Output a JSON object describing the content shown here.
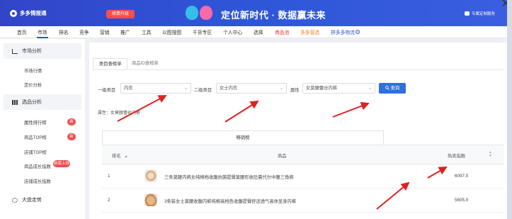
{
  "header": {
    "logo_text": "多多情报通",
    "upgrade_label": "续费升级",
    "slogan": "定位新时代 · 数据赢未来",
    "service_label": "专属定制服务",
    "close_symbol": "✕"
  },
  "nav": {
    "items": [
      {
        "label": "首页"
      },
      {
        "label": "市场"
      },
      {
        "label": "排名"
      },
      {
        "label": "竞争"
      },
      {
        "label": "营销"
      },
      {
        "label": "推广"
      },
      {
        "label": "工具"
      },
      {
        "label": "以图搜图"
      },
      {
        "label": "千货专区"
      },
      {
        "label": "个人中心"
      },
      {
        "label": "选择"
      },
      {
        "label": "商品池"
      },
      {
        "label": "多多营选"
      },
      {
        "label": "拼多多物流"
      }
    ],
    "help_symbol": "?",
    "active_index": 1
  },
  "sidebar": {
    "market_group": "市场分析",
    "market_items": [
      "市场行情",
      "定价分析"
    ],
    "selection_group": "选品分析",
    "selection_items": [
      "属性排行榜",
      "商品TOP榜",
      "店铺TOP榜",
      "商品成长指数",
      "店铺成长指数"
    ],
    "new_badge": "新",
    "trend_group": "大盘走势",
    "trend_badge": "新版上线"
  },
  "tabs": {
    "active": "类目查榜单",
    "inactive": "商品ID查榜单"
  },
  "filters": {
    "level1_label": "一级类目",
    "level1_value": "内衣",
    "level2_label": "二级类目",
    "level2_value": "女士内衣",
    "attr_label": "属性",
    "attr_value": "女莫腰蕾丝内裤",
    "query_label": "查询",
    "chevron": "⌄"
  },
  "attribute_summary": "属性：女莫腰蕾丝内裤",
  "table": {
    "list_tab": "畅销榜",
    "headers": {
      "rank": "排名",
      "product": "商品",
      "index": "热卖指数"
    },
    "rows": [
      {
        "rank": "1",
        "title": "三条莫腰内裤女纯棉档收腹抗菌提臀莫腰形收肚晨代尔中腰三角裤",
        "index": "6097.0"
      },
      {
        "rank": "2",
        "title": "3条装女士莫腰收腹内裤纯棉高档色收腹提臀舒适透气高体显身内裤",
        "index": "5605.0"
      }
    ]
  },
  "colors": {
    "brand": "#2f56d8",
    "danger": "#f04e4e",
    "query_button": "#2f6fe4",
    "annotation_arrow": "#e02020"
  }
}
